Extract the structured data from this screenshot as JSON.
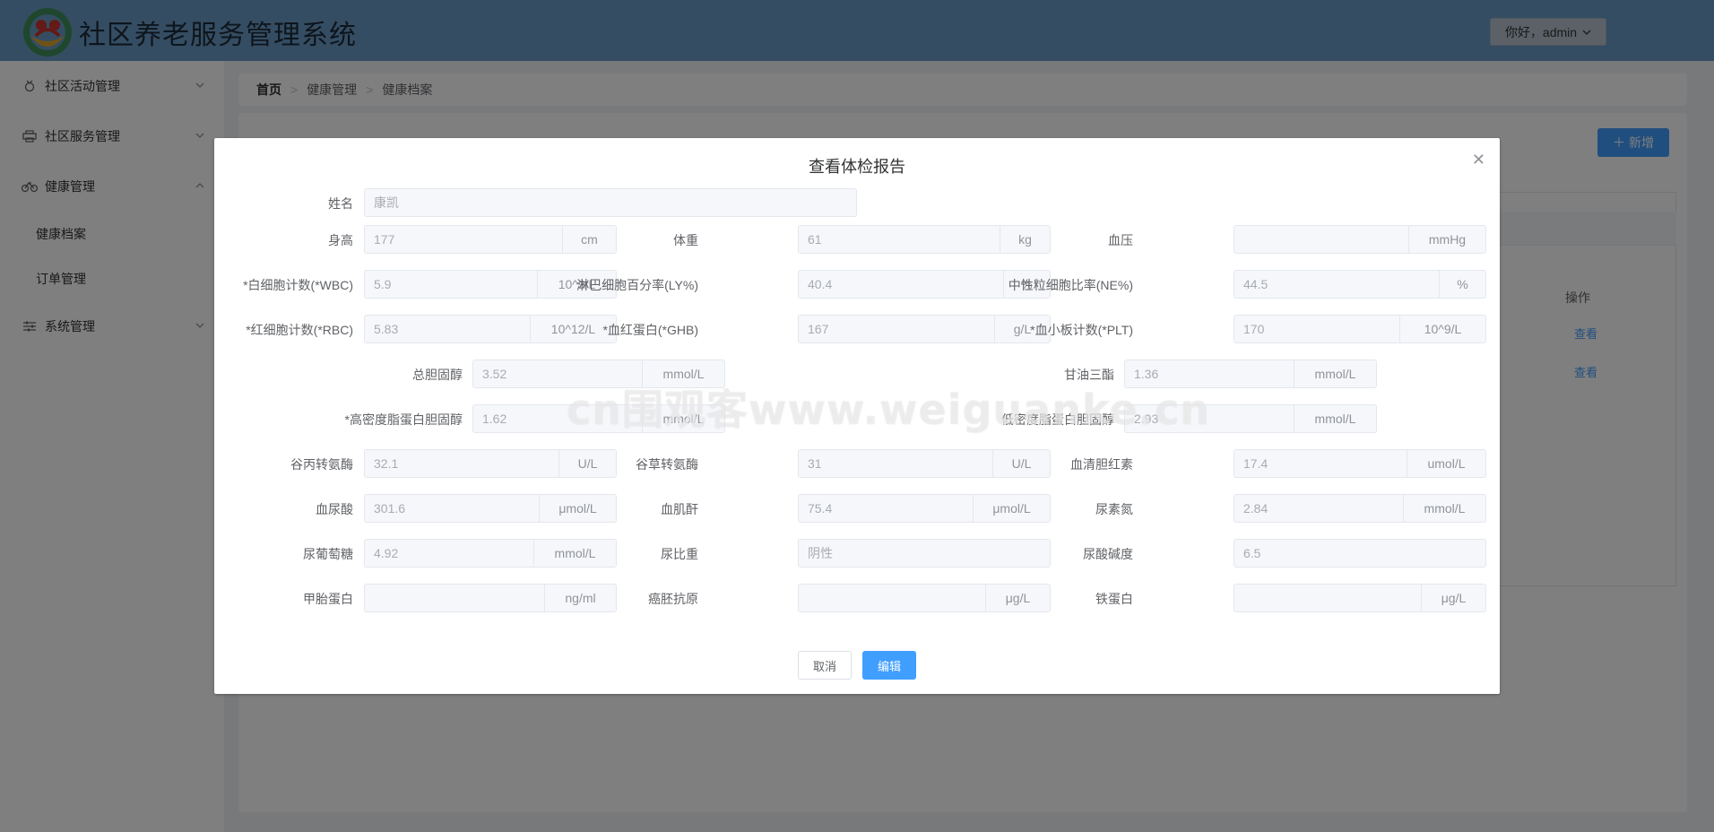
{
  "app": {
    "title": "社区养老服务管理系统",
    "user_greeting": "你好，admin"
  },
  "sidebar": {
    "items": [
      {
        "label": "社区活动管理",
        "icon": "badge-icon"
      },
      {
        "label": "社区服务管理",
        "icon": "printer-icon"
      },
      {
        "label": "健康管理",
        "icon": "bike-icon"
      },
      {
        "label": "系统管理",
        "icon": "sliders-icon"
      }
    ],
    "sub_items": [
      {
        "label": "健康档案"
      },
      {
        "label": "订单管理"
      }
    ]
  },
  "breadcrumb": {
    "home": "首页",
    "level1": "健康管理",
    "level2": "健康档案"
  },
  "main": {
    "add_label": "新增",
    "ops_header": "操作",
    "row_actions": [
      "查看",
      "查看"
    ]
  },
  "dialog": {
    "title": "查看体检报告",
    "name": {
      "label": "姓名",
      "value": "康凯"
    },
    "fields": [
      {
        "label": "身高",
        "value": "177",
        "unit": "cm"
      },
      {
        "label": "体重",
        "value": "61",
        "unit": "kg"
      },
      {
        "label": "血压",
        "value": "",
        "unit": "mmHg"
      },
      {
        "label": "*白细胞计数(*WBC)",
        "value": "5.9",
        "unit": "10^9/L"
      },
      {
        "label": "淋巴细胞百分率(LY%)",
        "value": "40.4",
        "unit": "%"
      },
      {
        "label": "中性粒细胞比率(NE%)",
        "value": "44.5",
        "unit": "%"
      },
      {
        "label": "*红细胞计数(*RBC)",
        "value": "5.83",
        "unit": "10^12/L"
      },
      {
        "label": "*血红蛋白(*GHB)",
        "value": "167",
        "unit": "g/L"
      },
      {
        "label": "*血小板计数(*PLT)",
        "value": "170",
        "unit": "10^9/L"
      },
      {
        "label": "总胆固醇",
        "value": "3.52",
        "unit": "mmol/L"
      },
      {
        "label": "甘油三酯",
        "value": "1.36",
        "unit": "mmol/L"
      },
      {
        "label": "*高密度脂蛋白胆固醇",
        "value": "1.62",
        "unit": "mmol/L"
      },
      {
        "label": "低密度脂蛋白胆固醇",
        "value": "2.93",
        "unit": "mmol/L"
      },
      {
        "label": "谷丙转氨酶",
        "value": "32.1",
        "unit": "U/L"
      },
      {
        "label": "谷草转氨酶",
        "value": "31",
        "unit": "U/L"
      },
      {
        "label": "血清胆红素",
        "value": "17.4",
        "unit": "umol/L"
      },
      {
        "label": "血尿酸",
        "value": "301.6",
        "unit": "μmol/L"
      },
      {
        "label": "血肌酐",
        "value": "75.4",
        "unit": "μmol/L"
      },
      {
        "label": "尿素氮",
        "value": "2.84",
        "unit": "mmol/L"
      },
      {
        "label": "尿葡萄糖",
        "value": "4.92",
        "unit": "mmol/L"
      },
      {
        "label": "尿比重",
        "value": "阴性",
        "unit": ""
      },
      {
        "label": "尿酸碱度",
        "value": "6.5",
        "unit": ""
      },
      {
        "label": "甲胎蛋白",
        "value": "",
        "unit": "ng/ml"
      },
      {
        "label": "癌胚抗原",
        "value": "",
        "unit": "μg/L"
      },
      {
        "label": "铁蛋白",
        "value": "",
        "unit": "μg/L"
      }
    ],
    "cancel_label": "取消",
    "edit_label": "编辑"
  },
  "watermark": "cn围观客www.weiguanke.cn"
}
